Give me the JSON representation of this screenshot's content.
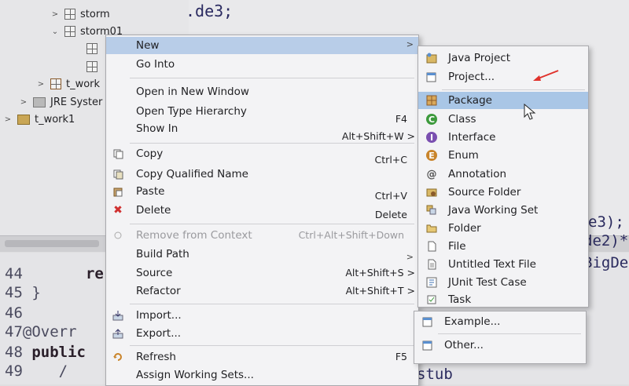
{
  "explorer": {
    "items": [
      {
        "label": "storm"
      },
      {
        "label": "storm01"
      },
      {
        "label": "t_work"
      },
      {
        "label": "JRE Syster"
      },
      {
        "label": "t_work1"
      }
    ]
  },
  "editor": {
    "top_text": ".de3;",
    "peek_lines": [
      "e3);",
      "de2)*",
      "BigDe",
      "stub"
    ]
  },
  "code": {
    "lines": [
      {
        "num": "44",
        "text": "re"
      },
      {
        "num": "45",
        "text": "}"
      },
      {
        "num": "46",
        "text": ""
      },
      {
        "num": "47",
        "text": "@Overr"
      },
      {
        "num": "48",
        "text": "public"
      },
      {
        "num": "49",
        "text": "/"
      }
    ]
  },
  "context_menu": {
    "items": [
      {
        "label": "New",
        "shortcut": "",
        "has_submenu": true,
        "highlighted": true
      },
      {
        "label": "Go Into",
        "shortcut": ""
      },
      {
        "label": "Open in New Window",
        "shortcut": ""
      },
      {
        "label": "Open Type Hierarchy",
        "shortcut": "F4"
      },
      {
        "label": "Show In",
        "shortcut": "Alt+Shift+W >"
      },
      {
        "label": "Copy",
        "shortcut": "Ctrl+C",
        "icon": "copy-icon"
      },
      {
        "label": "Copy Qualified Name",
        "shortcut": "",
        "icon": "copy-qualified-icon"
      },
      {
        "label": "Paste",
        "shortcut": "Ctrl+V",
        "icon": "paste-icon"
      },
      {
        "label": "Delete",
        "shortcut": "Delete",
        "icon": "delete-icon"
      },
      {
        "label": "Remove from Context",
        "shortcut": "Ctrl+Alt+Shift+Down",
        "disabled": true,
        "icon": "remove-context-icon"
      },
      {
        "label": "Build Path",
        "shortcut": "",
        "has_submenu": true
      },
      {
        "label": "Source",
        "shortcut": "Alt+Shift+S >"
      },
      {
        "label": "Refactor",
        "shortcut": "Alt+Shift+T >"
      },
      {
        "label": "Import...",
        "shortcut": "",
        "icon": "import-icon"
      },
      {
        "label": "Export...",
        "shortcut": "",
        "icon": "export-icon"
      },
      {
        "label": "Refresh",
        "shortcut": "F5",
        "icon": "refresh-icon"
      },
      {
        "label": "Assign Working Sets...",
        "shortcut": ""
      }
    ]
  },
  "new_submenu": {
    "items": [
      {
        "label": "Java Project",
        "icon": "java-project-icon"
      },
      {
        "label": "Project...",
        "icon": "project-icon"
      },
      {
        "label": "Package",
        "icon": "package-icon",
        "highlighted": true
      },
      {
        "label": "Class",
        "icon": "class-icon"
      },
      {
        "label": "Interface",
        "icon": "interface-icon"
      },
      {
        "label": "Enum",
        "icon": "enum-icon"
      },
      {
        "label": "Annotation",
        "icon": "annotation-icon"
      },
      {
        "label": "Source Folder",
        "icon": "source-folder-icon"
      },
      {
        "label": "Java Working Set",
        "icon": "working-set-icon"
      },
      {
        "label": "Folder",
        "icon": "folder-icon"
      },
      {
        "label": "File",
        "icon": "file-icon"
      },
      {
        "label": "Untitled Text File",
        "icon": "text-file-icon"
      },
      {
        "label": "JUnit Test Case",
        "icon": "junit-icon"
      },
      {
        "label": "Task",
        "icon": "task-icon"
      },
      {
        "label": "Example...",
        "icon": "example-icon"
      },
      {
        "label": "Other...",
        "icon": "other-icon"
      }
    ]
  },
  "glyphs": {
    "submenu_arrow": ">",
    "expanded": "⌄",
    "collapsed": ">",
    "class_letter": "C",
    "interface_letter": "I",
    "enum_letter": "E",
    "annotation_letter": "@",
    "delete_glyph": "✖",
    "cursor": "pointer-arrow"
  },
  "colors": {
    "highlight": "#b8cde8",
    "submenu_highlight": "#a9c6e6",
    "class_green": "#3d9a3d",
    "interface_purple": "#7a4fb0",
    "enum_orange": "#c9842a",
    "delete_red": "#d03030",
    "annotation_arrow": "#e0322c"
  }
}
